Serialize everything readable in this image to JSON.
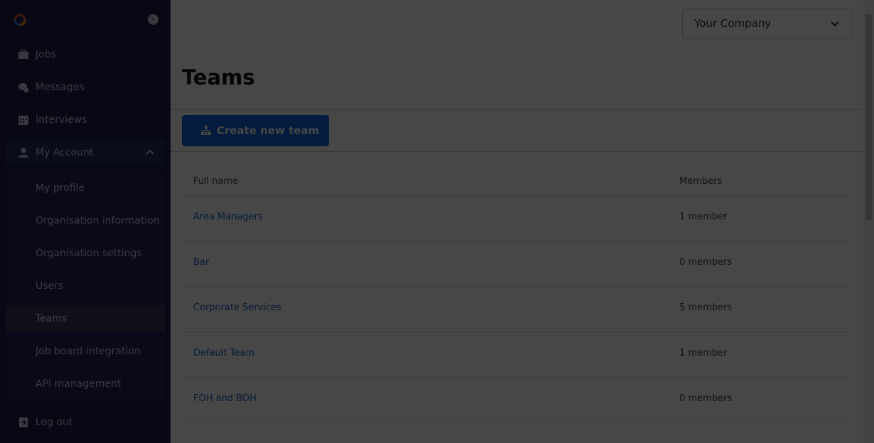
{
  "sidebar": {
    "nav": [
      {
        "label": "Jobs",
        "icon": "briefcase-icon"
      },
      {
        "label": "Messages",
        "icon": "chat-icon"
      },
      {
        "label": "Interviews",
        "icon": "calendar-icon"
      }
    ],
    "account_label": "My Account",
    "submenu": [
      {
        "label": "My profile"
      },
      {
        "label": "Organisation information"
      },
      {
        "label": "Organisation settings"
      },
      {
        "label": "Users"
      },
      {
        "label": "Teams"
      },
      {
        "label": "Job board integration"
      },
      {
        "label": "API management"
      }
    ],
    "logout_label": "Log out"
  },
  "header": {
    "company_select_value": "Your Company"
  },
  "page": {
    "title": "Teams",
    "create_button_label": "Create new team"
  },
  "table": {
    "columns": [
      "Full name",
      "Members"
    ],
    "rows": [
      {
        "name": "Area Managers",
        "members": "1 member"
      },
      {
        "name": "Bar",
        "members": "0 members"
      },
      {
        "name": "Corporate Services",
        "members": "5 members"
      },
      {
        "name": "Default Team",
        "members": "1 member"
      },
      {
        "name": "FOH and BOH",
        "members": "0 members"
      }
    ]
  },
  "colors": {
    "sidebar_bg": "#1b1d4a",
    "accent": "#0b63d6",
    "link": "#0d63c4"
  }
}
